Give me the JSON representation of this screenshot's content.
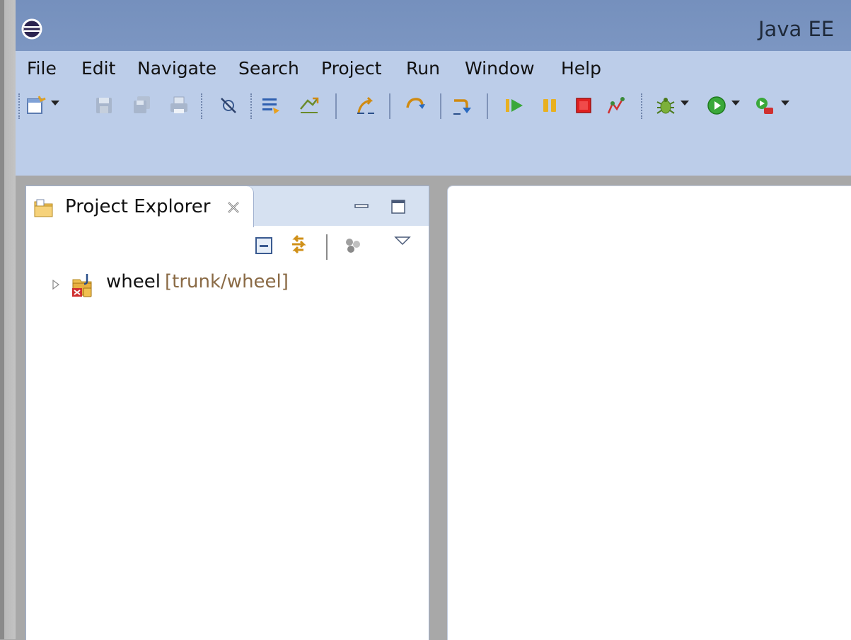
{
  "window": {
    "title": "Java EE",
    "app_icon": "eclipse-icon"
  },
  "menubar": {
    "items": [
      "File",
      "Edit",
      "Navigate",
      "Search",
      "Project",
      "Run",
      "Window",
      "Help"
    ]
  },
  "toolbar": {
    "icons": [
      "new-wizard-icon",
      "save-icon",
      "save-all-icon",
      "print-icon",
      "skip-breakpoints-icon",
      "toggle-mark-occurrences-icon",
      "toggle-block-selection-icon",
      "next-annotation-icon",
      "step-into-icon",
      "step-over-icon",
      "step-return-icon",
      "resume-icon",
      "suspend-icon",
      "terminate-icon",
      "disconnect-icon",
      "debug-icon",
      "run-icon",
      "external-tools-icon"
    ]
  },
  "project_explorer": {
    "tab_label": "Project Explorer",
    "tab_icon": "project-explorer-icon",
    "view_toolbar": [
      "collapse-all-icon",
      "link-with-editor-icon",
      "filters-icon",
      "view-menu-icon"
    ],
    "tree": [
      {
        "name": "wheel",
        "svn_path": "[trunk/wheel]",
        "icon": "java-project-icon",
        "expanded": false
      }
    ]
  },
  "colors": {
    "titlebar": "#7c96c2",
    "toolbar": "#bccde9",
    "view_header": "#d6e1f1",
    "svn_path_text": "#8a6a45"
  }
}
